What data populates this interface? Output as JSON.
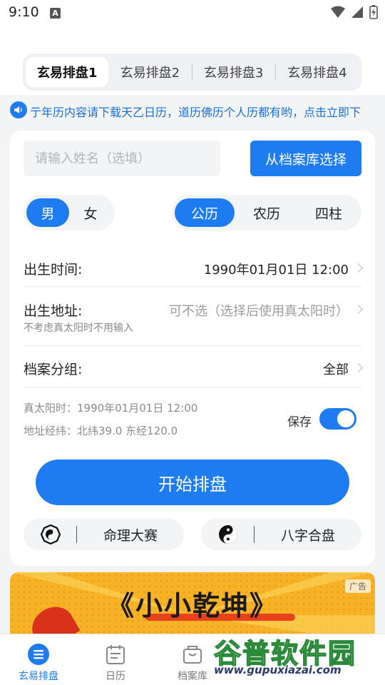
{
  "status_bar": {
    "time": "9:10",
    "indicator": "A"
  },
  "tabs": [
    {
      "label": "玄易排盘1",
      "active": true
    },
    {
      "label": "玄易排盘2",
      "active": false
    },
    {
      "label": "玄易排盘3",
      "active": false
    },
    {
      "label": "玄易排盘4",
      "active": false
    }
  ],
  "notice": {
    "text": "亍年历内容请下载天乙日历，道历佛历个人历都有哟，点击立即下"
  },
  "form": {
    "name_placeholder": "请输入姓名（选填）",
    "archive_button": "从档案库选择",
    "gender": {
      "male": "男",
      "female": "女",
      "selected": "男"
    },
    "calendar": {
      "solar": "公历",
      "lunar": "农历",
      "pillars": "四柱",
      "selected": "公历"
    },
    "birth_time": {
      "label": "出生时间:",
      "value": "1990年01月01日 12:00"
    },
    "birth_place": {
      "label": "出生地址:",
      "placeholder": "可不选（选择后使用真太阳时）",
      "hint": "不考虑真太阳时不用输入"
    },
    "group": {
      "label": "档案分组:",
      "value": "全部"
    },
    "true_solar_time": "真太阳时：1990年01月01日 12:00",
    "coordinates": "地址经纬：北纬39.0 东经120.0",
    "save_label": "保存",
    "save_enabled": true,
    "start_button": "开始排盘"
  },
  "features": [
    {
      "label": "命理大赛",
      "icon": "bagua-icon"
    },
    {
      "label": "八字合盘",
      "icon": "yin-yang-icon"
    }
  ],
  "ad": {
    "tag": "广告",
    "title": "《小小乾坤》"
  },
  "bottom_nav": [
    {
      "label": "玄易排盘",
      "icon": "chart-icon",
      "active": true
    },
    {
      "label": "日历",
      "icon": "calendar-icon",
      "active": false
    },
    {
      "label": "档案库",
      "icon": "archive-icon",
      "active": false
    }
  ],
  "watermark": {
    "text": "谷普软件园",
    "url": "www.gupuxiazai.com"
  },
  "colors": {
    "accent": "#1e7cf0",
    "background": "#f3f4f6",
    "ad_bg": "#f6b326"
  }
}
